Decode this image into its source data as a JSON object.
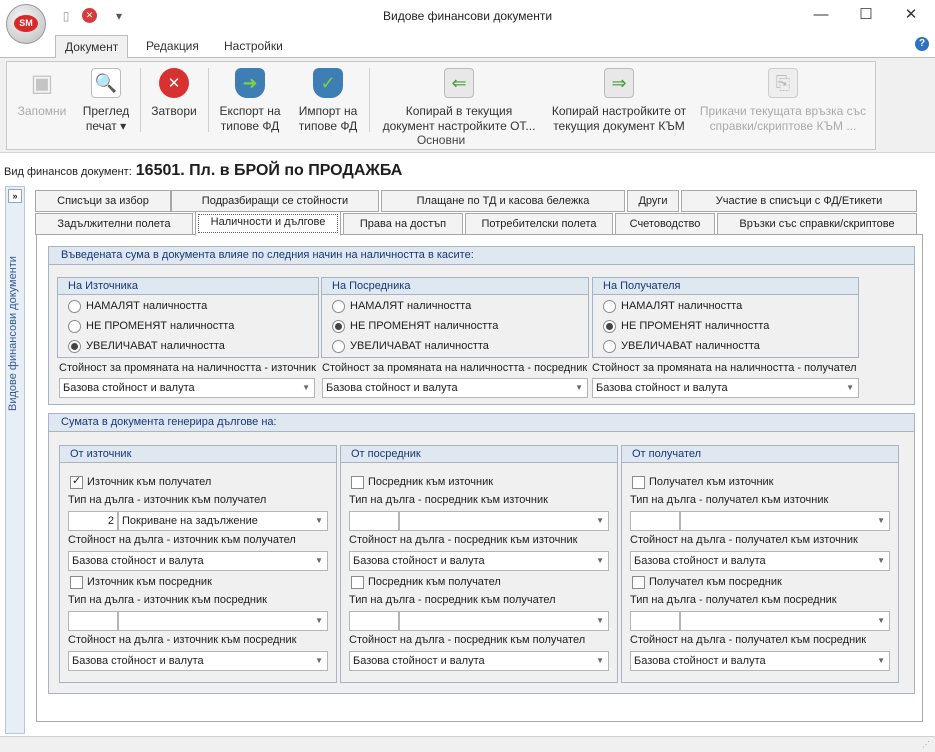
{
  "window": {
    "title": "Видове финансови документи",
    "logo_text": "SM"
  },
  "ribbon_tabs": [
    "Документ",
    "Редакция",
    "Настройки"
  ],
  "ribbon": {
    "group_label": "Основни",
    "save": "Запомни",
    "preview_l1": "Преглед",
    "preview_l2": "печат",
    "close": "Затвори",
    "export_l1": "Експорт на",
    "export_l2": "типове ФД",
    "import_l1": "Импорт на",
    "import_l2": "типове ФД",
    "copy_from_l1": "Копирай в текущия",
    "copy_from_l2": "документ настройките ОТ...",
    "copy_to_l1": "Копирай настройките от",
    "copy_to_l2": "текущия документ КЪМ",
    "attach_l1": "Прикачи текущата връзка със",
    "attach_l2": "справки/скриптове КЪМ ..."
  },
  "doc": {
    "label": "Вид финансов документ:",
    "value": "16501. Пл. в БРОЙ по ПРОДАЖБА"
  },
  "sidebar": {
    "label": "Видове финансови документи",
    "expand": "»"
  },
  "tabs_row1": [
    "Списъци за избор",
    "Подразбиращи се стойности",
    "Плащане по ТД и касова бележка",
    "Други",
    "Участие в списъци с ФД/Етикети"
  ],
  "tabs_row2": [
    "Задължителни полета",
    "Наличности и дългове",
    "Права на достъп",
    "Потребителски полета",
    "Счетоводство",
    "Връзки със справки/скриптове"
  ],
  "inventory": {
    "title": "Въведената сума в документа влияе по следния начин на наличността в касите:",
    "opt_decrease": "НАМАЛЯТ наличността",
    "opt_keep": "НЕ ПРОМЕНЯТ наличността",
    "opt_increase": "УВЕЛИЧАВАТ наличността",
    "source": {
      "title": "На Източника",
      "value_label": "Стойност за промяната на наличността - източник",
      "value": "Базова стойност и валута"
    },
    "mediator": {
      "title": "На Посредника",
      "value_label": "Стойност за промяната на наличността - посредник",
      "value": "Базова стойност и валута"
    },
    "receiver": {
      "title": "На Получателя",
      "value_label": "Стойност за промяната на наличността - получател",
      "value": "Базова стойност и валута"
    }
  },
  "debts": {
    "title": "Сумата в документа генерира дългове на:",
    "from_source": {
      "title": "От източник",
      "chk1": "Източник към получател",
      "type1_label": "Тип на дълга - източник към получател",
      "type1_code": "2",
      "type1_value": "Покриване на задължение",
      "val1_label": "Стойност на дълга - източник към получател",
      "val1": "Базова стойност и валута",
      "chk2": "Източник към посредник",
      "type2_label": "Тип на дълга - източник към посредник",
      "val2_label": "Стойност на дълга - източник към посредник",
      "val2": "Базова стойност и валута"
    },
    "from_mediator": {
      "title": "От посредник",
      "chk1": "Посредник към източник",
      "type1_label": "Тип на дълга - посредник към източник",
      "val1_label": "Стойност на дълга - посредник към източник",
      "val1": "Базова стойност и валута",
      "chk2": "Посредник към получател",
      "type2_label": "Тип на дълга - посредник към получател",
      "val2_label": "Стойност на дълга - посредник към получател",
      "val2": "Базова стойност и валута"
    },
    "from_receiver": {
      "title": "От получател",
      "chk1": "Получател към източник",
      "type1_label": "Тип на дълга - получател към източник",
      "val1_label": "Стойност на дълга - получател към източник",
      "val1": "Базова стойност и валута",
      "chk2": "Получател към посредник",
      "type2_label": "Тип на дълга - получател към посредник",
      "val2_label": "Стойност на дълга - получател към посредник",
      "val2": "Базова стойност и валута"
    }
  }
}
